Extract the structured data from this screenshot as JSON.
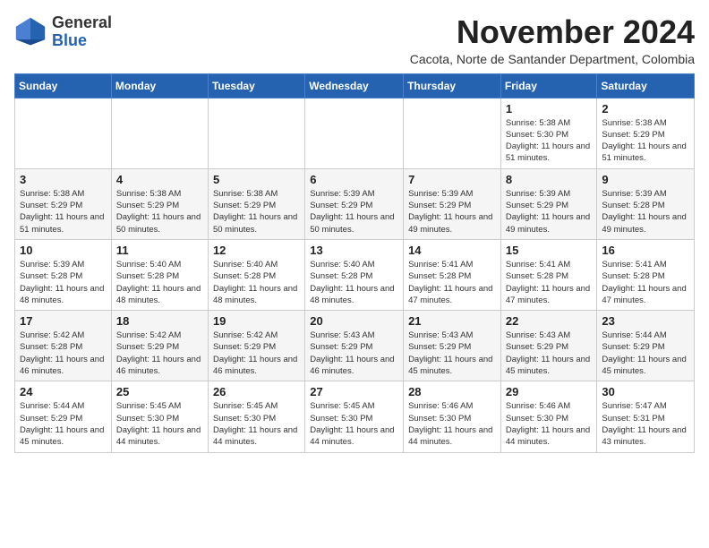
{
  "logo": {
    "general": "General",
    "blue": "Blue"
  },
  "header": {
    "month": "November 2024",
    "location": "Cacota, Norte de Santander Department, Colombia"
  },
  "weekdays": [
    "Sunday",
    "Monday",
    "Tuesday",
    "Wednesday",
    "Thursday",
    "Friday",
    "Saturday"
  ],
  "weeks": [
    [
      {
        "day": "",
        "info": ""
      },
      {
        "day": "",
        "info": ""
      },
      {
        "day": "",
        "info": ""
      },
      {
        "day": "",
        "info": ""
      },
      {
        "day": "",
        "info": ""
      },
      {
        "day": "1",
        "info": "Sunrise: 5:38 AM\nSunset: 5:30 PM\nDaylight: 11 hours and 51 minutes."
      },
      {
        "day": "2",
        "info": "Sunrise: 5:38 AM\nSunset: 5:29 PM\nDaylight: 11 hours and 51 minutes."
      }
    ],
    [
      {
        "day": "3",
        "info": "Sunrise: 5:38 AM\nSunset: 5:29 PM\nDaylight: 11 hours and 51 minutes."
      },
      {
        "day": "4",
        "info": "Sunrise: 5:38 AM\nSunset: 5:29 PM\nDaylight: 11 hours and 50 minutes."
      },
      {
        "day": "5",
        "info": "Sunrise: 5:38 AM\nSunset: 5:29 PM\nDaylight: 11 hours and 50 minutes."
      },
      {
        "day": "6",
        "info": "Sunrise: 5:39 AM\nSunset: 5:29 PM\nDaylight: 11 hours and 50 minutes."
      },
      {
        "day": "7",
        "info": "Sunrise: 5:39 AM\nSunset: 5:29 PM\nDaylight: 11 hours and 49 minutes."
      },
      {
        "day": "8",
        "info": "Sunrise: 5:39 AM\nSunset: 5:29 PM\nDaylight: 11 hours and 49 minutes."
      },
      {
        "day": "9",
        "info": "Sunrise: 5:39 AM\nSunset: 5:28 PM\nDaylight: 11 hours and 49 minutes."
      }
    ],
    [
      {
        "day": "10",
        "info": "Sunrise: 5:39 AM\nSunset: 5:28 PM\nDaylight: 11 hours and 48 minutes."
      },
      {
        "day": "11",
        "info": "Sunrise: 5:40 AM\nSunset: 5:28 PM\nDaylight: 11 hours and 48 minutes."
      },
      {
        "day": "12",
        "info": "Sunrise: 5:40 AM\nSunset: 5:28 PM\nDaylight: 11 hours and 48 minutes."
      },
      {
        "day": "13",
        "info": "Sunrise: 5:40 AM\nSunset: 5:28 PM\nDaylight: 11 hours and 48 minutes."
      },
      {
        "day": "14",
        "info": "Sunrise: 5:41 AM\nSunset: 5:28 PM\nDaylight: 11 hours and 47 minutes."
      },
      {
        "day": "15",
        "info": "Sunrise: 5:41 AM\nSunset: 5:28 PM\nDaylight: 11 hours and 47 minutes."
      },
      {
        "day": "16",
        "info": "Sunrise: 5:41 AM\nSunset: 5:28 PM\nDaylight: 11 hours and 47 minutes."
      }
    ],
    [
      {
        "day": "17",
        "info": "Sunrise: 5:42 AM\nSunset: 5:28 PM\nDaylight: 11 hours and 46 minutes."
      },
      {
        "day": "18",
        "info": "Sunrise: 5:42 AM\nSunset: 5:29 PM\nDaylight: 11 hours and 46 minutes."
      },
      {
        "day": "19",
        "info": "Sunrise: 5:42 AM\nSunset: 5:29 PM\nDaylight: 11 hours and 46 minutes."
      },
      {
        "day": "20",
        "info": "Sunrise: 5:43 AM\nSunset: 5:29 PM\nDaylight: 11 hours and 46 minutes."
      },
      {
        "day": "21",
        "info": "Sunrise: 5:43 AM\nSunset: 5:29 PM\nDaylight: 11 hours and 45 minutes."
      },
      {
        "day": "22",
        "info": "Sunrise: 5:43 AM\nSunset: 5:29 PM\nDaylight: 11 hours and 45 minutes."
      },
      {
        "day": "23",
        "info": "Sunrise: 5:44 AM\nSunset: 5:29 PM\nDaylight: 11 hours and 45 minutes."
      }
    ],
    [
      {
        "day": "24",
        "info": "Sunrise: 5:44 AM\nSunset: 5:29 PM\nDaylight: 11 hours and 45 minutes."
      },
      {
        "day": "25",
        "info": "Sunrise: 5:45 AM\nSunset: 5:30 PM\nDaylight: 11 hours and 44 minutes."
      },
      {
        "day": "26",
        "info": "Sunrise: 5:45 AM\nSunset: 5:30 PM\nDaylight: 11 hours and 44 minutes."
      },
      {
        "day": "27",
        "info": "Sunrise: 5:45 AM\nSunset: 5:30 PM\nDaylight: 11 hours and 44 minutes."
      },
      {
        "day": "28",
        "info": "Sunrise: 5:46 AM\nSunset: 5:30 PM\nDaylight: 11 hours and 44 minutes."
      },
      {
        "day": "29",
        "info": "Sunrise: 5:46 AM\nSunset: 5:30 PM\nDaylight: 11 hours and 44 minutes."
      },
      {
        "day": "30",
        "info": "Sunrise: 5:47 AM\nSunset: 5:31 PM\nDaylight: 11 hours and 43 minutes."
      }
    ]
  ]
}
